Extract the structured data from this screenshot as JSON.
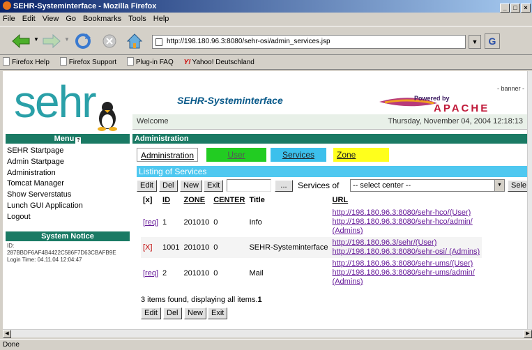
{
  "window": {
    "title": "SEHR-Systeminterface - Mozilla Firefox",
    "controls": [
      "_",
      "□",
      "×"
    ]
  },
  "menubar": [
    "File",
    "Edit",
    "View",
    "Go",
    "Bookmarks",
    "Tools",
    "Help"
  ],
  "navigation": {
    "url": "http://198.180.96.3:8080/sehr-osi/admin_services.jsp",
    "go_label": "G"
  },
  "bookmarks": [
    "Firefox Help",
    "Firefox Support",
    "Plug-in FAQ",
    "Yahoo! Deutschland"
  ],
  "banner": {
    "logo_text": "sehr",
    "title": "SEHR-Systeminterface",
    "tag": "- banner -",
    "powered_by": "Powered by",
    "apache": "APACHE",
    "welcome": "Welcome",
    "datetime": "Thursday, November 04, 2004 12:18:13"
  },
  "sidebar": {
    "menu_header": "Menu",
    "items": [
      "SEHR Startpage",
      "Admin Startpage",
      "Administration",
      "Tomcat Manager",
      "Show Serverstatus",
      "Lunch GUI Application",
      "Logout"
    ],
    "system_notice_header": "System Notice",
    "id_line": "ID:",
    "id_value": "287BBDF6AF4B4422C586F7D63CBAFB9E",
    "login_time": "Login Time: 04.11.04 12:04:47"
  },
  "main": {
    "header": "Administration",
    "tabs": [
      {
        "label": "Administration",
        "bg": "#ffffff"
      },
      {
        "label": "User",
        "bg": "#22cc22"
      },
      {
        "label": "Services",
        "bg": "#3cc0ec"
      },
      {
        "label": "Zone",
        "bg": "#ffff1c"
      }
    ],
    "listing_title": "Listing of Services",
    "toolbar": {
      "edit": "Edit",
      "del": "Del",
      "new": "New",
      "exit": "Exit",
      "ellipsis": "...",
      "services_of": "Services of",
      "select_center": "-- select center --",
      "sele": "Sele"
    },
    "table": {
      "headers": [
        "[x]",
        "ID",
        "ZONE",
        "CENTER",
        "Title",
        "URL"
      ],
      "rows": [
        {
          "flag": "[req]",
          "id": "1",
          "zone": "201010",
          "center": "0",
          "title": "Info",
          "urls": [
            "http://198.180.96.3:8080/sehr-hco/(User)",
            "http://198.180.96.3:8080/sehr-hco/admin/",
            "(Admins)"
          ]
        },
        {
          "flag": "[X]",
          "id": "1001",
          "zone": "201010",
          "center": "0",
          "title": "SEHR-Systeminterface",
          "urls": [
            "http://198.180.96.3/sehr/(User)",
            "http://198.180.96.3:8080/sehr-osi/ (Admins)"
          ]
        },
        {
          "flag": "[req]",
          "id": "2",
          "zone": "201010",
          "center": "0",
          "title": "Mail",
          "urls": [
            "http://198.180.96.3:8080/sehr-ums/(User)",
            "http://198.180.96.3:8080/sehr-ums/admin/",
            "(Admins)"
          ]
        }
      ]
    },
    "found_text": "3 items found, displaying all items.",
    "page_number": "1"
  },
  "status": "Done"
}
